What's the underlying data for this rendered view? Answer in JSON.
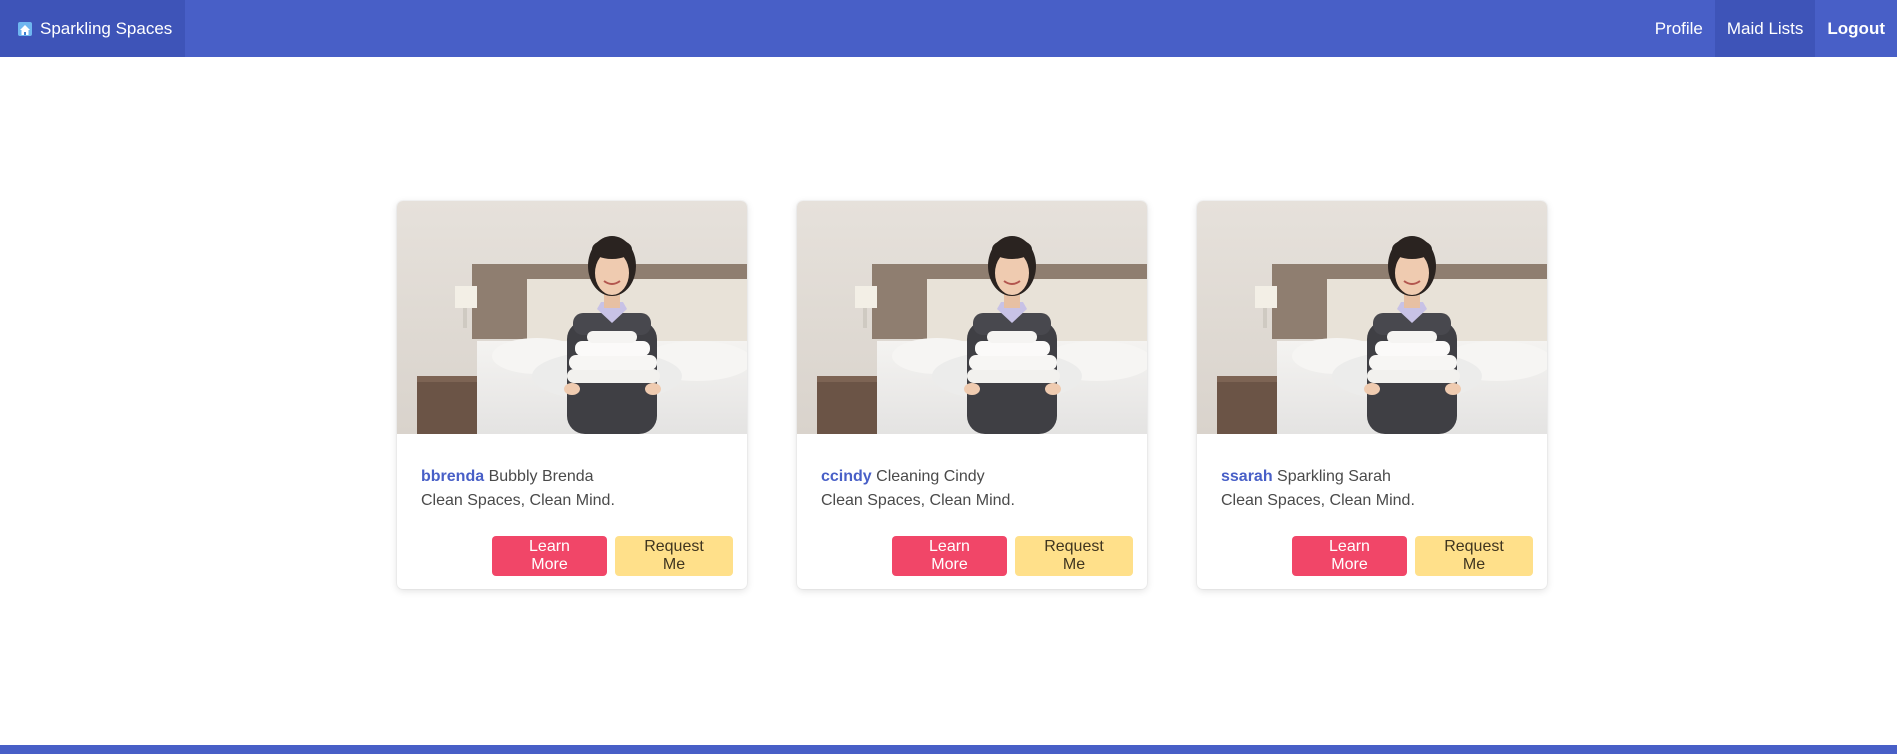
{
  "navbar": {
    "brand": {
      "label": "Sparkling Spaces",
      "icon": "house-logo-icon"
    },
    "items": [
      {
        "label": "Profile",
        "active": false,
        "bold": false
      },
      {
        "label": "Maid Lists",
        "active": true,
        "bold": false
      },
      {
        "label": "Logout",
        "active": false,
        "bold": true
      }
    ]
  },
  "cards": [
    {
      "username": "bbrenda",
      "name": "Bubbly Brenda",
      "tagline": "Clean Spaces, Clean Mind.",
      "learn_label": "Learn More",
      "request_label": "Request Me"
    },
    {
      "username": "ccindy",
      "name": "Cleaning Cindy",
      "tagline": "Clean Spaces, Clean Mind.",
      "learn_label": "Learn More",
      "request_label": "Request Me"
    },
    {
      "username": "ssarah",
      "name": "Sparkling Sarah",
      "tagline": "Clean Spaces, Clean Mind.",
      "learn_label": "Learn More",
      "request_label": "Request Me"
    }
  ],
  "colors": {
    "primary": "#485fc7",
    "danger": "#f14668",
    "warning": "#ffe08a"
  }
}
